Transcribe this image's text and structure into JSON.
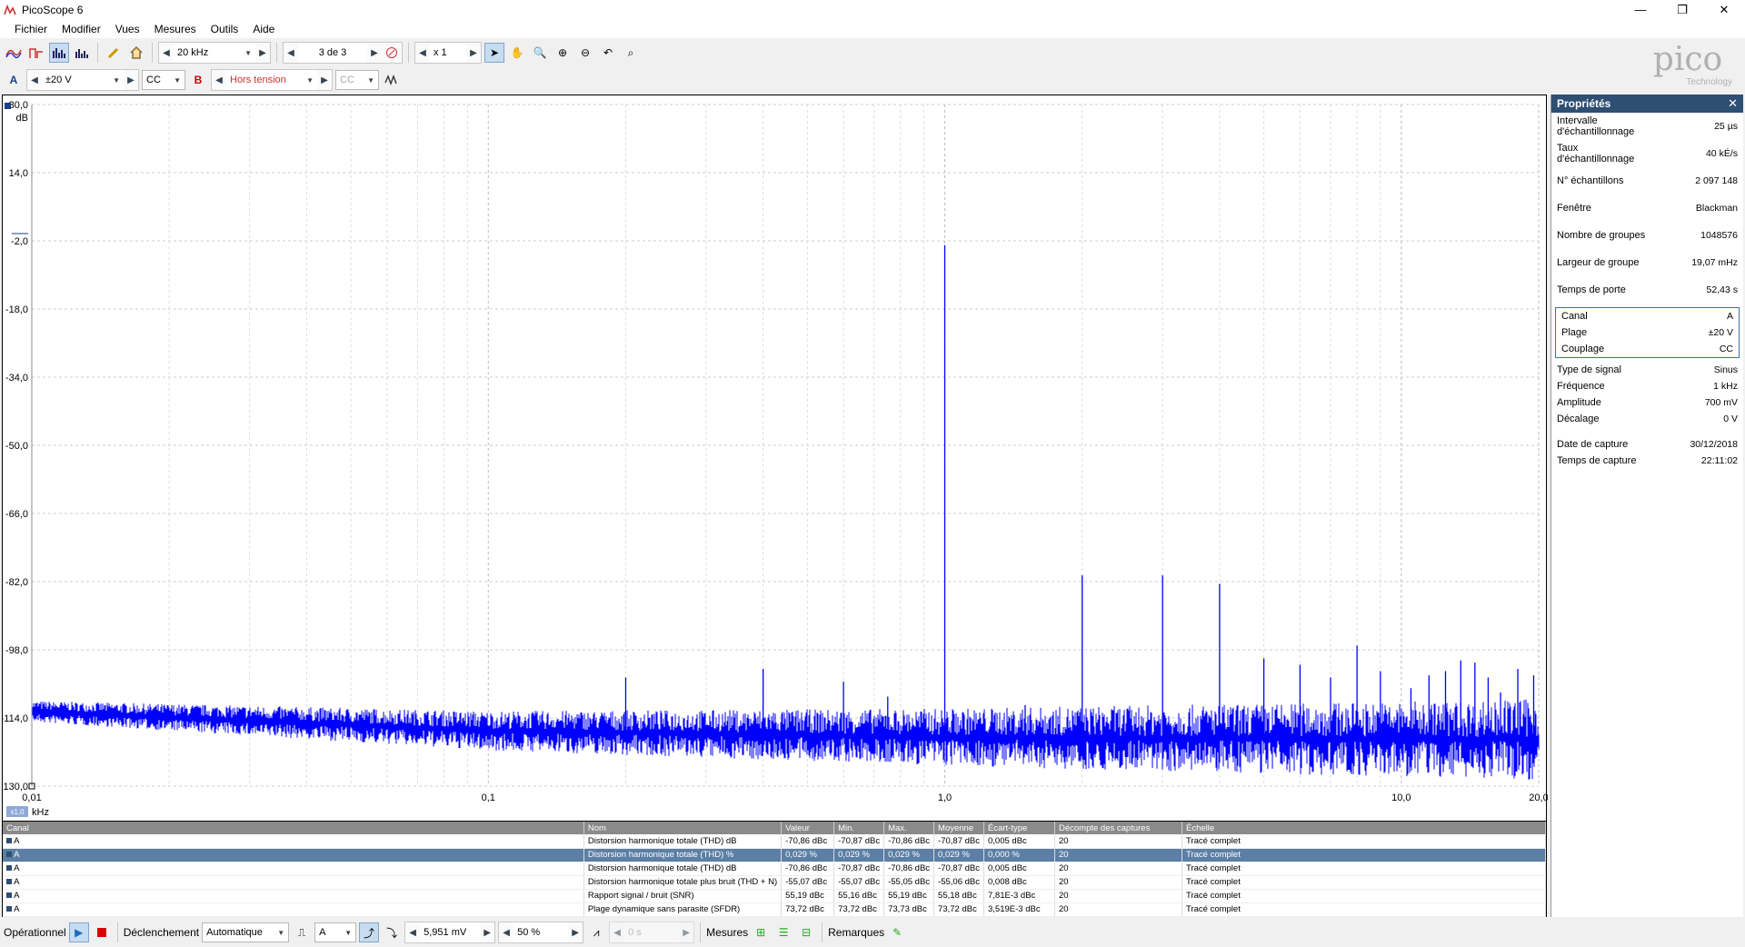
{
  "window": {
    "title": "PicoScope 6",
    "minimize": "—",
    "maximize": "❐",
    "close": "✕"
  },
  "menu": [
    "Fichier",
    "Modifier",
    "Vues",
    "Mesures",
    "Outils",
    "Aide"
  ],
  "toolbar1": {
    "frequency": "20 kHz",
    "capture_index": "3 de 3",
    "zoom_factor": "x 1"
  },
  "toolbar2": {
    "channel_a": "A",
    "range_a": "±20 V",
    "coupling_a": "CC",
    "channel_b": "B",
    "range_b": "Hors tension",
    "coupling_b": "CC"
  },
  "logo": {
    "main": "pico",
    "sub": "Technology"
  },
  "colors": {
    "trace": "#0000ff",
    "header": "#2e4e72",
    "selected_row": "#5b7fa6"
  },
  "chart_data": {
    "type": "line",
    "x_scale": "log",
    "xlim": [
      0.01,
      20.0
    ],
    "ylim": [
      -130.0,
      30.0
    ],
    "ylabel": "dB",
    "xlabel": "kHz",
    "x_unit_badge": "x1,0",
    "y_ticks": [
      "30,0",
      "14,0",
      "-2,0",
      "-18,0",
      "-34,0",
      "-50,0",
      "-66,0",
      "-82,0",
      "-98,0",
      "-114,0",
      "-130,0"
    ],
    "x_ticks": [
      "0,01",
      "0,1",
      "1,0",
      "10,0",
      "20,0"
    ],
    "series": [
      {
        "noise_floor": [
          [
            0.01,
            -112.0
          ],
          [
            0.1,
            -116.5
          ],
          [
            1.0,
            -118.0
          ],
          [
            10.0,
            -118.5
          ],
          [
            20.0,
            -118.5
          ]
        ],
        "peaks": [
          [
            0.2,
            -104.5
          ],
          [
            0.4,
            -102.5
          ],
          [
            0.6,
            -105.5
          ],
          [
            0.75,
            -109.0
          ],
          [
            1.0,
            -3.0
          ],
          [
            1.5,
            -111.0
          ],
          [
            2.0,
            -80.5
          ],
          [
            3.0,
            -80.5
          ],
          [
            4.0,
            -82.5
          ],
          [
            5.0,
            -100.0
          ],
          [
            6.0,
            -101.5
          ],
          [
            7.0,
            -104.5
          ],
          [
            8.0,
            -97.0
          ],
          [
            9.0,
            -103.0
          ],
          [
            10.5,
            -107.0
          ],
          [
            11.5,
            -104.0
          ],
          [
            12.5,
            -103.0
          ],
          [
            13.5,
            -100.5
          ],
          [
            14.5,
            -101.0
          ],
          [
            15.5,
            -104.5
          ],
          [
            16.5,
            -108.0
          ],
          [
            18.0,
            -102.5
          ],
          [
            19.5,
            -104.0
          ]
        ]
      }
    ]
  },
  "properties": {
    "title": "Propriétés",
    "close": "✕",
    "rows1": [
      {
        "label": "Intervalle d'échantillonnage",
        "value": "25 µs"
      },
      {
        "label": "Taux d'échantillonnage",
        "value": "40 kÉ/s"
      },
      {
        "label": "N° échantillons",
        "value": "2 097 148"
      },
      {
        "label": "Fenêtre",
        "value": "Blackman"
      },
      {
        "label": "Nombre de groupes",
        "value": "1048576"
      },
      {
        "label": "Largeur de groupe",
        "value": "19,07 mHz"
      },
      {
        "label": "Temps de porte",
        "value": "52,43 s"
      }
    ],
    "channel_box": [
      {
        "label": "Canal",
        "value": "A"
      },
      {
        "label": "Plage",
        "value": "±20 V"
      },
      {
        "label": "Couplage",
        "value": "CC"
      }
    ],
    "rows2": [
      {
        "label": "Type de signal",
        "value": "Sinus"
      },
      {
        "label": "Fréquence",
        "value": "1 kHz"
      },
      {
        "label": "Amplitude",
        "value": "700 mV"
      },
      {
        "label": "Décalage",
        "value": "0 V"
      }
    ],
    "rows3": [
      {
        "label": "Date de capture",
        "value": "30/12/2018"
      },
      {
        "label": "Temps de capture",
        "value": "22:11:02"
      }
    ]
  },
  "measurements": {
    "headers": [
      "Canal",
      "Nom",
      "Valeur",
      "Min.",
      "Max.",
      "Moyenne",
      "Écart-type",
      "Décompte des captures",
      "Échelle"
    ],
    "rows": [
      [
        "A",
        "Distorsion harmonique totale (THD) dB",
        "-70,86 dBc",
        "-70,87 dBc",
        "-70,86 dBc",
        "-70,87 dBc",
        "0,005 dBc",
        "20",
        "Tracé complet"
      ],
      [
        "A",
        "Distorsion harmonique totale (THD) %",
        "0,029 %",
        "0,029 %",
        "0,029 %",
        "0,029 %",
        "0,000 %",
        "20",
        "Tracé complet"
      ],
      [
        "A",
        "Distorsion harmonique totale (THD) dB",
        "-70,86 dBc",
        "-70,87 dBc",
        "-70,86 dBc",
        "-70,87 dBc",
        "0,005 dBc",
        "20",
        "Tracé complet"
      ],
      [
        "A",
        "Distorsion harmonique totale plus bruit (THD + N)",
        "-55,07 dBc",
        "-55,07 dBc",
        "-55,05 dBc",
        "-55,06 dBc",
        "0,008 dBc",
        "20",
        "Tracé complet"
      ],
      [
        "A",
        "Rapport signal / bruit (SNR)",
        "55,19 dBc",
        "55,16 dBc",
        "55,19 dBc",
        "55,18 dBc",
        "7,81E-3 dBc",
        "20",
        "Tracé complet"
      ],
      [
        "A",
        "Plage dynamique sans parasite (SFDR)",
        "73,72 dBc",
        "73,72 dBc",
        "73,73 dBc",
        "73,72 dBc",
        "3,519E-3 dBc",
        "20",
        "Tracé complet"
      ]
    ],
    "selected_row": 1
  },
  "status": {
    "mode": "Opérationnel",
    "trigger_label": "Déclenchement",
    "trigger_mode": "Automatique",
    "trigger_channel": "A",
    "threshold": "5,951 mV",
    "pretrigger": "50 %",
    "delay": "0 s",
    "measures": "Mesures",
    "notes": "Remarques"
  }
}
